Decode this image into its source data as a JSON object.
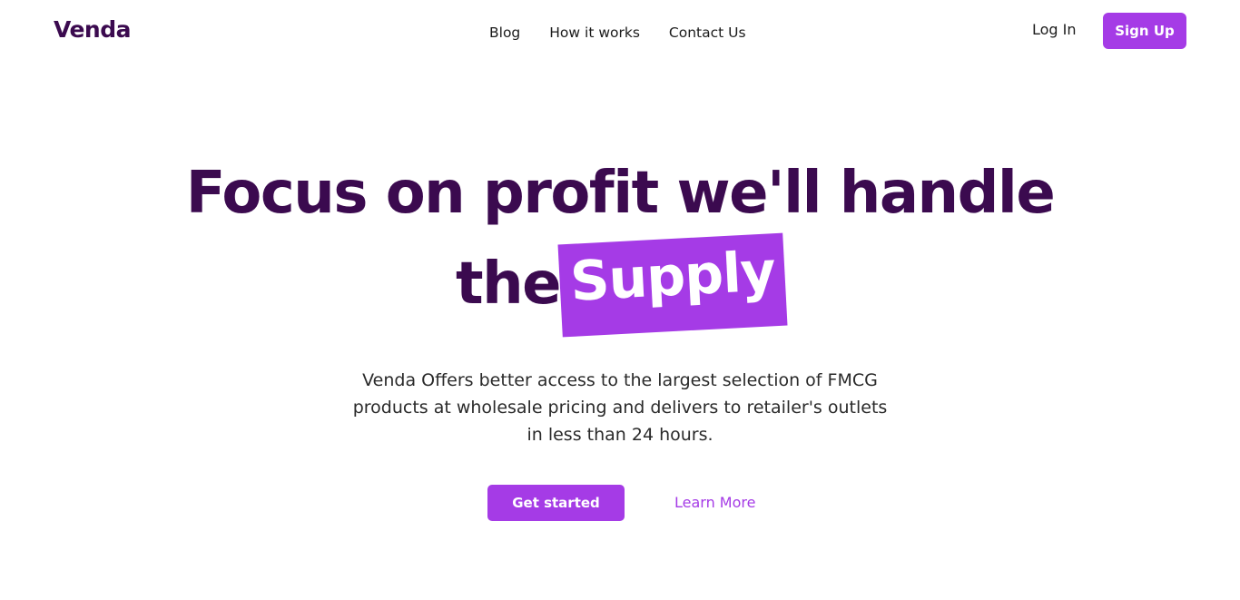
{
  "brand": {
    "name": "Venda",
    "color": "#3b0a4f",
    "accent": "#a53be6"
  },
  "nav": {
    "items": [
      {
        "label": "Blog"
      },
      {
        "label": "How it works"
      },
      {
        "label": "Contact Us"
      }
    ],
    "login_label": "Log In",
    "signup_label": "Sign Up"
  },
  "hero": {
    "headline_line1": "Focus on profit we'll handle",
    "headline_line2": "the",
    "highlight": "Supply",
    "subtext": "Venda Offers better access to the largest selection of FMCG products at wholesale pricing and delivers to retailer's outlets in less than 24 hours.",
    "primary_cta": "Get started",
    "secondary_cta": "Learn More"
  }
}
